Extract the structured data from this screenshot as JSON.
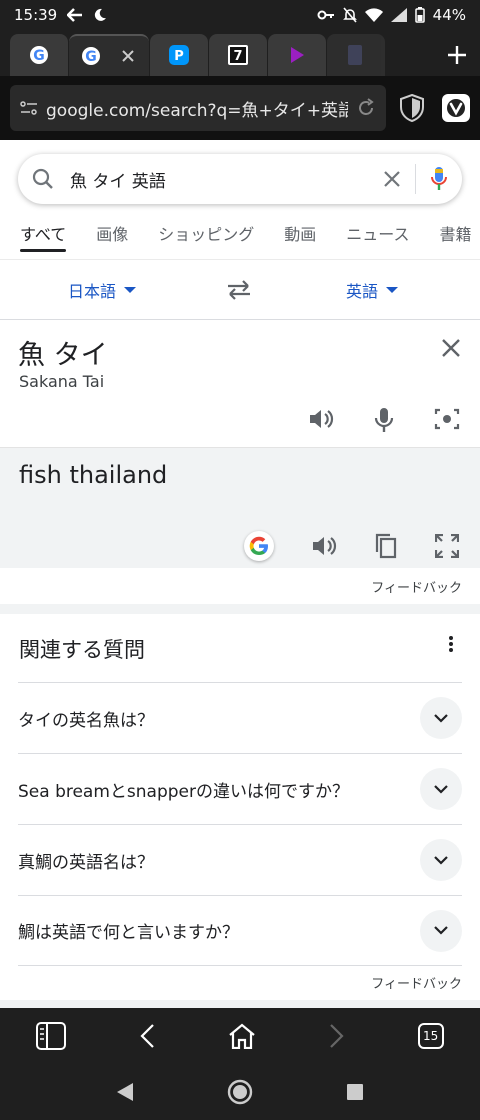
{
  "status": {
    "time": "15:39",
    "battery": "44%"
  },
  "tabs": {
    "count": "15"
  },
  "address": {
    "url": "google.com/search?q=魚+タイ+英語"
  },
  "search": {
    "query": "魚 タイ 英語"
  },
  "nav_tabs": [
    "すべて",
    "画像",
    "ショッピング",
    "動画",
    "ニュース",
    "書籍"
  ],
  "translate": {
    "source_lang": "日本語",
    "target_lang": "英語",
    "source_text": "魚 タイ",
    "romanization": "Sakana Tai",
    "result_text": "fish thailand",
    "feedback": "フィードバック"
  },
  "paa": {
    "title": "関連する質問",
    "questions": [
      "タイの英名魚は？",
      "Sea breamとsnapperの違いは何ですか？",
      "真鯛の英語名は？",
      "鯛は英語で何と言いますか？"
    ],
    "feedback": "フィードバック"
  },
  "colors": {
    "link_blue": "#1a56c4",
    "chrome_dark": "#1f1f1f"
  }
}
